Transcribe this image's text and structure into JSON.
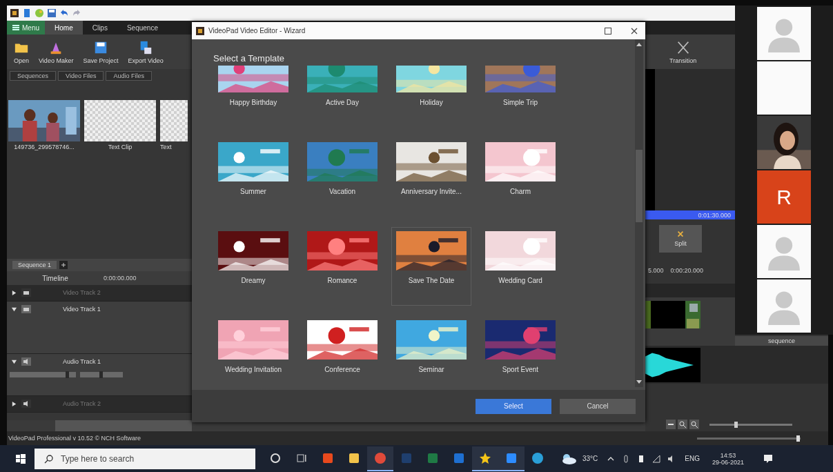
{
  "app": {
    "menu_button": "Menu",
    "tabs": [
      {
        "label": "Home",
        "selected": true
      },
      {
        "label": "Clips",
        "selected": false
      },
      {
        "label": "Sequence",
        "selected": false
      }
    ],
    "ribbon": [
      {
        "label": "Open",
        "kind": "folder"
      },
      {
        "label": "Video Maker",
        "kind": "maker"
      },
      {
        "label": "Save Project",
        "kind": "save"
      },
      {
        "label": "Export Video",
        "kind": "export"
      }
    ],
    "ribbon_right": [
      {
        "label": "Transition",
        "kind": "cross"
      }
    ],
    "bin_tabs": [
      "Sequences",
      "Video Files",
      "Audio Files"
    ],
    "media": [
      {
        "label": "149736_299578746...",
        "kind": "picture"
      },
      {
        "label": "Text Clip",
        "kind": "text"
      },
      {
        "label": "Text",
        "kind": "text"
      }
    ],
    "sequence_tab": "Sequence 1",
    "timeline_label": "Timeline",
    "timecode": "0:00:00.000",
    "tracks": [
      {
        "name": "Video Track 2",
        "kind": "video",
        "expanded": false
      },
      {
        "name": "Video Track 1",
        "kind": "video",
        "expanded": true
      },
      {
        "name": "Audio Track 1",
        "kind": "audio",
        "expanded": true,
        "volume": {
          "level": 0.88
        },
        "pan": {
          "level": 0.5
        }
      },
      {
        "name": "Audio Track 2",
        "kind": "audio",
        "expanded": false
      }
    ],
    "zoom_slider": {
      "level": 0.3
    },
    "master_volume": {
      "level": 0.98
    },
    "preview_time": "0:01:30.000",
    "split_button": "Split",
    "ruler": [
      "5.000",
      "0:00:20.000"
    ],
    "clip_note": "sequence",
    "status_bar": "VideoPad Professional v 10.52 © NCH Software"
  },
  "dialog": {
    "title": "VideoPad Video Editor - Wizard",
    "heading": "Select a Template",
    "templates": [
      {
        "label": "Happy Birthday",
        "selected": false
      },
      {
        "label": "Active Day",
        "selected": false
      },
      {
        "label": "Holiday",
        "selected": false
      },
      {
        "label": "Simple Trip",
        "selected": false
      },
      {
        "label": "Summer",
        "selected": false
      },
      {
        "label": "Vacation",
        "selected": false
      },
      {
        "label": "Anniversary Invite...",
        "selected": false
      },
      {
        "label": "Charm",
        "selected": false
      },
      {
        "label": "Dreamy",
        "selected": false
      },
      {
        "label": "Romance",
        "selected": false
      },
      {
        "label": "Save The Date",
        "selected": true
      },
      {
        "label": "Wedding Card",
        "selected": false
      },
      {
        "label": "Wedding Invitation",
        "selected": false
      },
      {
        "label": "Conference",
        "selected": false
      },
      {
        "label": "Seminar",
        "selected": false
      },
      {
        "label": "Sport Event",
        "selected": false
      }
    ],
    "buttons": [
      {
        "label": "Select",
        "kind": "primary"
      },
      {
        "label": "Cancel",
        "kind": "secondary"
      }
    ]
  },
  "meeting": {
    "participants": [
      {
        "kind": "avatar"
      },
      {
        "kind": "blank"
      },
      {
        "kind": "video"
      },
      {
        "kind": "initial",
        "initial": "R",
        "color": "#d8431a"
      },
      {
        "kind": "avatar"
      },
      {
        "kind": "avatar"
      }
    ]
  },
  "taskbar": {
    "search": {
      "placeholder": "Type here to search"
    },
    "apps": [
      {
        "kind": "cortana",
        "active": false
      },
      {
        "kind": "taskview",
        "active": false
      },
      {
        "kind": "office",
        "active": false
      },
      {
        "kind": "explorer",
        "active": false
      },
      {
        "kind": "chrome",
        "active": true
      },
      {
        "kind": "photoshop",
        "active": false
      },
      {
        "kind": "excel",
        "active": false
      },
      {
        "kind": "outlook",
        "active": false
      },
      {
        "kind": "star",
        "active": true
      },
      {
        "kind": "zoom",
        "active": true
      },
      {
        "kind": "edge",
        "active": false
      }
    ],
    "weather": "33°C",
    "language": "ENG",
    "time": "14:53",
    "date": "29-06-2021"
  }
}
